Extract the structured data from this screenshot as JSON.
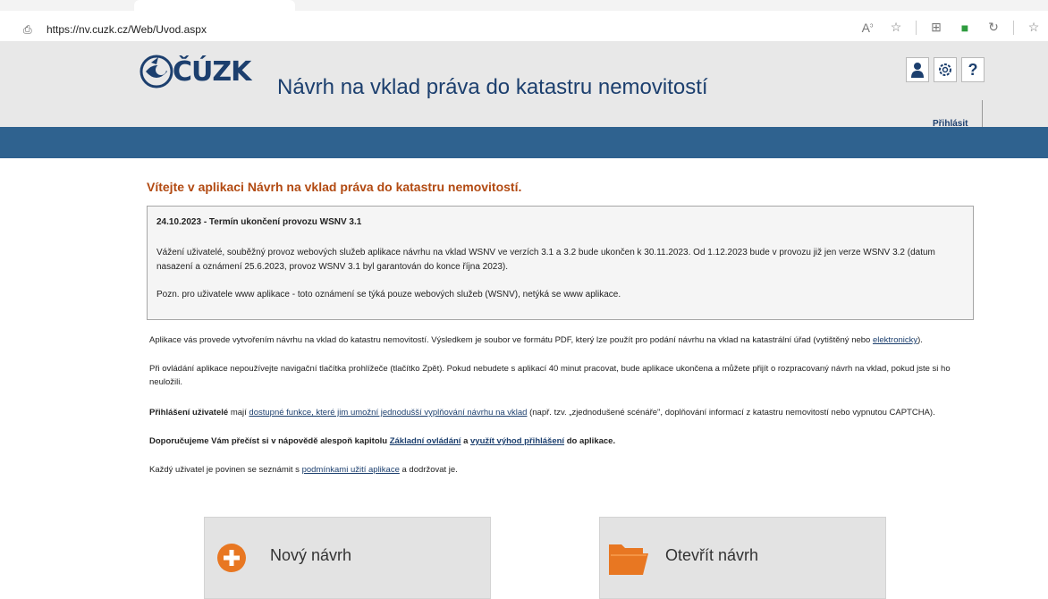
{
  "browser": {
    "url": "https://nv.cuzk.cz/Web/Uvod.aspx"
  },
  "header": {
    "logo_text": "ČÚZK",
    "title": "Návrh na vklad práva do katastru nemovitostí",
    "icons": [
      "user-icon",
      "gear-icon",
      "help-icon"
    ],
    "help_label": "?",
    "login_label": "Přihlásit"
  },
  "content": {
    "welcome": "Vítejte v aplikaci Návrh na vklad práva do katastru nemovitostí.",
    "notice": {
      "title": "24.10.2023 - Termín ukončení provozu WSNV 3.1",
      "body": "Vážení uživatelé, souběžný provoz webových služeb aplikace návrhu na vklad WSNV ve verzích 3.1 a 3.2 bude ukončen k 30.11.2023. Od 1.12.2023 bude v provozu již jen verze WSNV 3.2 (datum nasazení a oznámení 25.6.2023, provoz WSNV 3.1 byl garantován do konce října 2023).",
      "note": "Pozn. pro uživatele www aplikace - toto oznámení se týká pouze webových služeb (WSNV), netýká se www aplikace."
    },
    "p1_text": "Aplikace vás provede vytvořením návrhu na vklad do katastru nemovitostí. Výsledkem je soubor ve formátu PDF, který lze použít pro podání návrhu na vklad na katastrální úřad (vytištěný nebo ",
    "p1_link": "elektronicky",
    "p1_end": ").",
    "p2_text": "Při ovládání aplikace nepoužívejte navigační tlačítka prohlížeče (tlačítko Zpět). Pokud nebudete s aplikací 40 minut pracovat, bude aplikace ukončena a můžete přijít o rozpracovaný návrh na vklad, pokud jste si ho neuložili.",
    "p3_bold": "Přihlášení uživatelé",
    "p3_mid": " mají ",
    "p3_link": "dostupné funkce, které jim umožní jednodušší vyplňování návrhu na vklad",
    "p3_end": " (např. tzv. „zjednodušené scénáře\", doplňování informací z katastru nemovitostí nebo vypnutou CAPTCHA).",
    "p4_text": "Doporučujeme Vám přečíst si v nápovědě alespoň kapitolu ",
    "p4_link1": "Základní ovládání",
    "p4_and": " a ",
    "p4_link2": "využít výhod přihlášení",
    "p4_end": " do aplikace.",
    "p5_text": "Každý uživatel je povinen se seznámit s ",
    "p5_link": "podmínkami užití aplikace",
    "p5_end": " a dodržovat je."
  },
  "actions": {
    "new_label": "Nový návrh",
    "open_label": "Otevřít návrh"
  },
  "colors": {
    "brand": "#1c3f6e",
    "band": "#2f628f",
    "accent": "#e87722",
    "welcome": "#b24a12"
  }
}
